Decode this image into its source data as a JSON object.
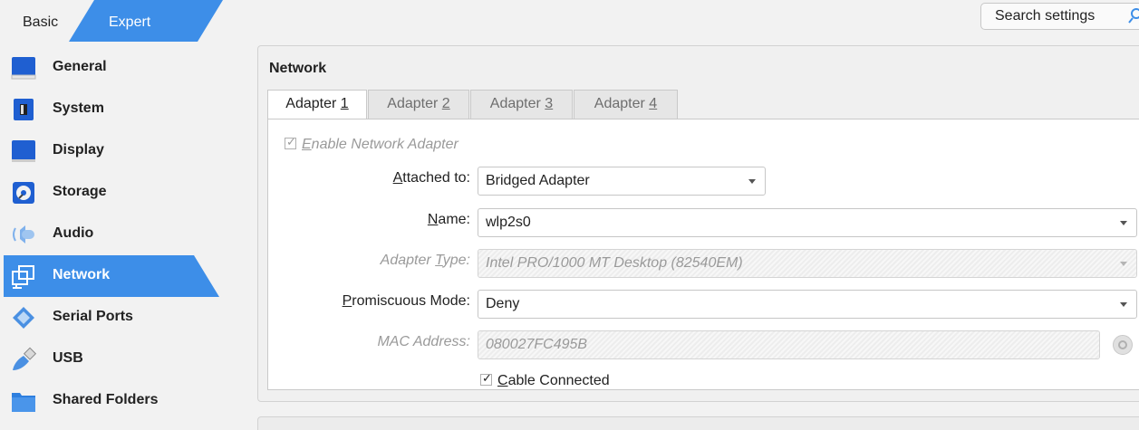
{
  "mode_tabs": {
    "basic": "Basic",
    "expert": "Expert"
  },
  "search": {
    "label": "Search settings",
    "icon": "search-icon"
  },
  "sidebar": {
    "items": [
      {
        "label": "General",
        "icon": "general-icon",
        "selected": false
      },
      {
        "label": "System",
        "icon": "system-icon",
        "selected": false
      },
      {
        "label": "Display",
        "icon": "display-icon",
        "selected": false
      },
      {
        "label": "Storage",
        "icon": "storage-icon",
        "selected": false
      },
      {
        "label": "Audio",
        "icon": "audio-icon",
        "selected": false
      },
      {
        "label": "Network",
        "icon": "network-icon",
        "selected": true
      },
      {
        "label": "Serial Ports",
        "icon": "serial-ports-icon",
        "selected": false
      },
      {
        "label": "USB",
        "icon": "usb-icon",
        "selected": false
      },
      {
        "label": "Shared Folders",
        "icon": "shared-folders-icon",
        "selected": false
      }
    ]
  },
  "panel": {
    "title": "Network",
    "tabs": [
      {
        "label_pre": "Adapter ",
        "label_key": "1",
        "active": true
      },
      {
        "label_pre": "Adapter ",
        "label_key": "2",
        "active": false
      },
      {
        "label_pre": "Adapter ",
        "label_key": "3",
        "active": false
      },
      {
        "label_pre": "Adapter ",
        "label_key": "4",
        "active": false
      }
    ],
    "enable_adapter": {
      "key": "E",
      "rest": "nable Network Adapter",
      "checked": true
    },
    "attached_to": {
      "label_key": "A",
      "label_rest": "ttached to:",
      "value": "Bridged Adapter"
    },
    "name": {
      "label_key": "N",
      "label_rest": "ame:",
      "value": "wlp2s0"
    },
    "adapter_type": {
      "label_pre": "Adapter ",
      "label_key": "T",
      "label_rest": "ype:",
      "value": "Intel PRO/1000 MT Desktop (82540EM)"
    },
    "promiscuous": {
      "label_key": "P",
      "label_rest": "romiscuous Mode:",
      "value": "Deny"
    },
    "mac": {
      "label": "MAC Address:",
      "value": "080027FC495B"
    },
    "cable": {
      "key": "C",
      "rest": "able Connected",
      "checked": true
    }
  },
  "colors": {
    "accent": "#3d8ee8",
    "selected_text": "#ffffff"
  }
}
